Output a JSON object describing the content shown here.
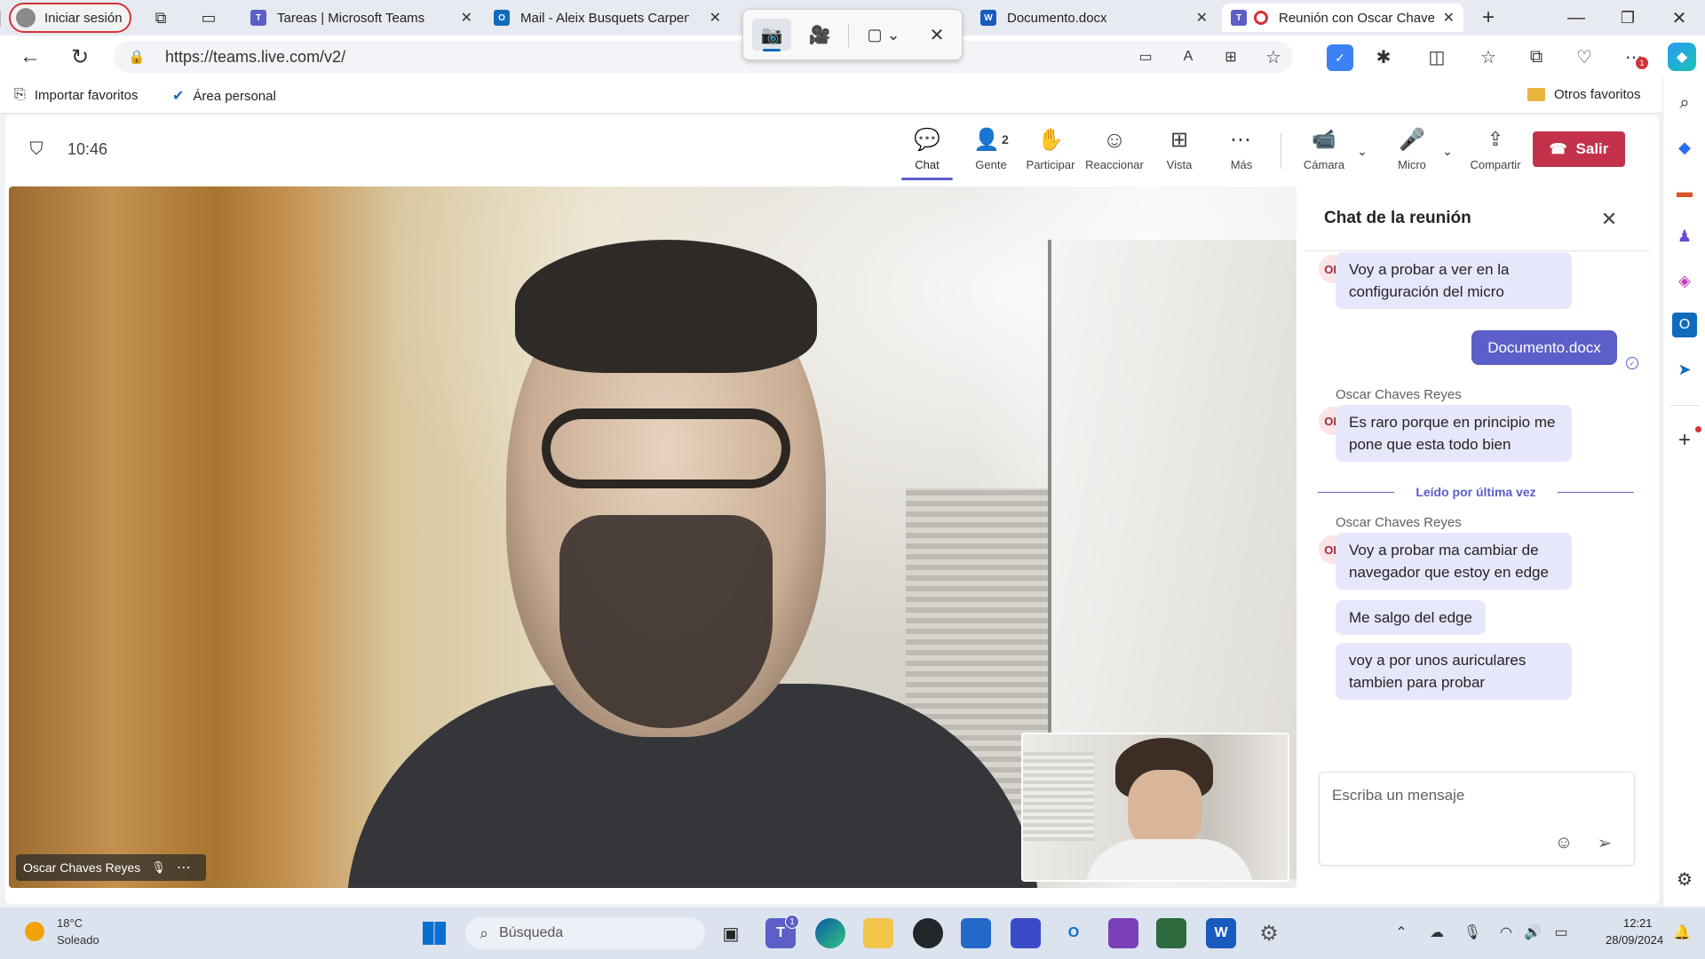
{
  "browser": {
    "profile_label": "Iniciar sesión",
    "tabs": [
      {
        "title": "Tareas | Microsoft Teams"
      },
      {
        "title": "Mail - Aleix Busquets Carpena"
      },
      {
        "title": "Documento.docx"
      },
      {
        "title": "Reunión con Oscar Chaves"
      }
    ],
    "url": "https://teams.live.com/v2/",
    "favorites": [
      {
        "label": "Importar favoritos"
      },
      {
        "label": "Área personal"
      }
    ],
    "other_favorites": "Otros favoritos",
    "extension_badge": "1"
  },
  "meeting": {
    "time": "10:46",
    "toolbar": {
      "chat": "Chat",
      "people": "Gente",
      "people_count": "2",
      "raise": "Participar",
      "react": "Reaccionar",
      "view": "Vista",
      "more": "Más",
      "camera": "Cámara",
      "mic": "Micro",
      "share": "Compartir",
      "leave": "Salir"
    },
    "participant_name": "Oscar Chaves Reyes"
  },
  "chat": {
    "title": "Chat de la reunión",
    "avatar_initials": "OR",
    "messages": [
      {
        "text": "Voy a probar a ver en la configuración del micro"
      },
      {
        "text": "Documento.docx"
      },
      {
        "sender": "Oscar Chaves Reyes",
        "text": "Es raro porque en principio me pone que esta todo bien"
      },
      {
        "sender": "Oscar Chaves Reyes",
        "text": "Voy a probar ma cambiar de navegador que estoy en edge"
      },
      {
        "text": "Me salgo del edge"
      },
      {
        "text": "voy a por unos auriculares tambien para probar"
      }
    ],
    "last_read": "Leído por última vez",
    "input_placeholder": "Escriba un mensaje"
  },
  "taskbar": {
    "temperature": "18°C",
    "weather": "Soleado",
    "search_placeholder": "Búsqueda",
    "teams_badge": "1",
    "time": "12:21",
    "date": "28/09/2024"
  },
  "colors": {
    "teams_purple": "#5b5fc7",
    "bubble": "#e6e7fb",
    "leave_red": "#c4314b"
  }
}
